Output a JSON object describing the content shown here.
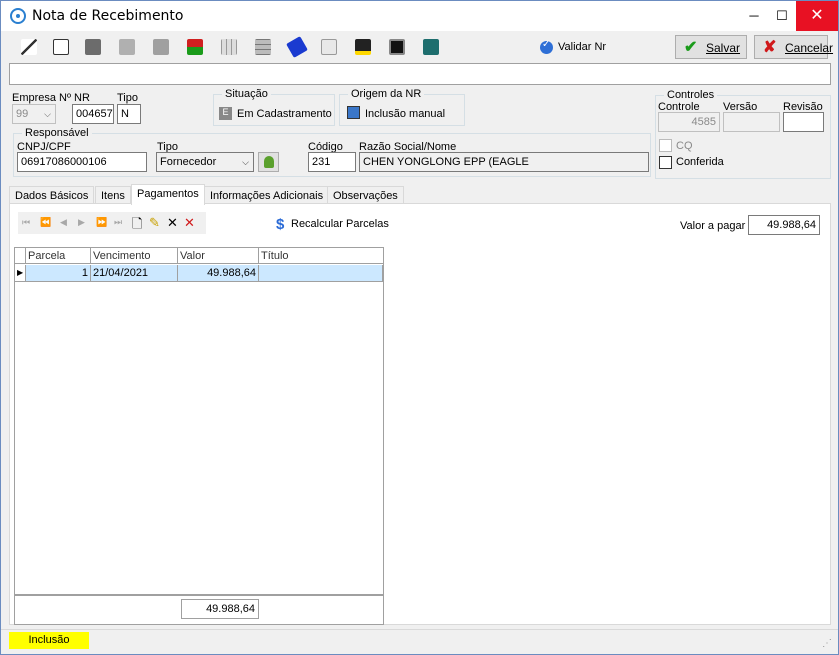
{
  "window": {
    "title": "Nota de Recebimento"
  },
  "toolbar": {
    "validar_label": "Validar Nr",
    "salvar_label": "Salvar",
    "cancelar_label": "Cancelar",
    "icons": [
      "wand-icon",
      "print-preview-icon",
      "printer-icon",
      "copy-icon",
      "document-tools-icon",
      "truck-icon",
      "grid-icon",
      "grid-alt-icon",
      "tag-icon",
      "auto-icon",
      "filter-icon",
      "image-icon",
      "export-icon"
    ],
    "colors": {
      "salvar_check": "#1a9b1a",
      "cancelar_x": "#d0191b"
    }
  },
  "header": {
    "empresa_label": "Empresa",
    "empresa_value": "99",
    "nr_label": "Nº NR",
    "nr_value": "004657",
    "tipo_label": "Tipo",
    "tipo_value": "N",
    "situacao_title": "Situação",
    "situacao_value": "Em Cadastramento",
    "origem_title": "Origem da NR",
    "origem_value": "Inclusão manual",
    "responsavel_title": "Responsável",
    "cnpj_label": "CNPJ/CPF",
    "cnpj_value": "06917086000106",
    "resp_tipo_label": "Tipo",
    "resp_tipo_value": "Fornecedor",
    "codigo_label": "Código",
    "codigo_value": "231",
    "razao_label": "Razão Social/Nome",
    "razao_value": "CHEN YONGLONG  EPP (EAGLE"
  },
  "controles": {
    "title": "Controles",
    "controle_label": "Controle",
    "controle_value": "4585",
    "versao_label": "Versão",
    "versao_value": "",
    "revisao_label": "Revisão",
    "revisao_value": "",
    "cq_label": "CQ",
    "conferida_label": "Conferida"
  },
  "tabs": [
    {
      "label": "Dados Básicos"
    },
    {
      "label": "Itens"
    },
    {
      "label": "Pagamentos"
    },
    {
      "label": "Informações Adicionais"
    },
    {
      "label": "Observações"
    }
  ],
  "pagamentos": {
    "recalcular_label": "Recalcular Parcelas",
    "valor_a_pagar_label": "Valor a pagar",
    "valor_a_pagar_value": "49.988,64",
    "columns": [
      "Parcela",
      "Vencimento",
      "Valor",
      "Título"
    ],
    "rows": [
      {
        "parcela": "1",
        "vencimento": "21/04/2021",
        "valor": "49.988,64",
        "titulo": ""
      }
    ],
    "total": "49.988,64"
  },
  "status": {
    "mode": "Inclusão",
    "mode_color": "#ffff00"
  }
}
